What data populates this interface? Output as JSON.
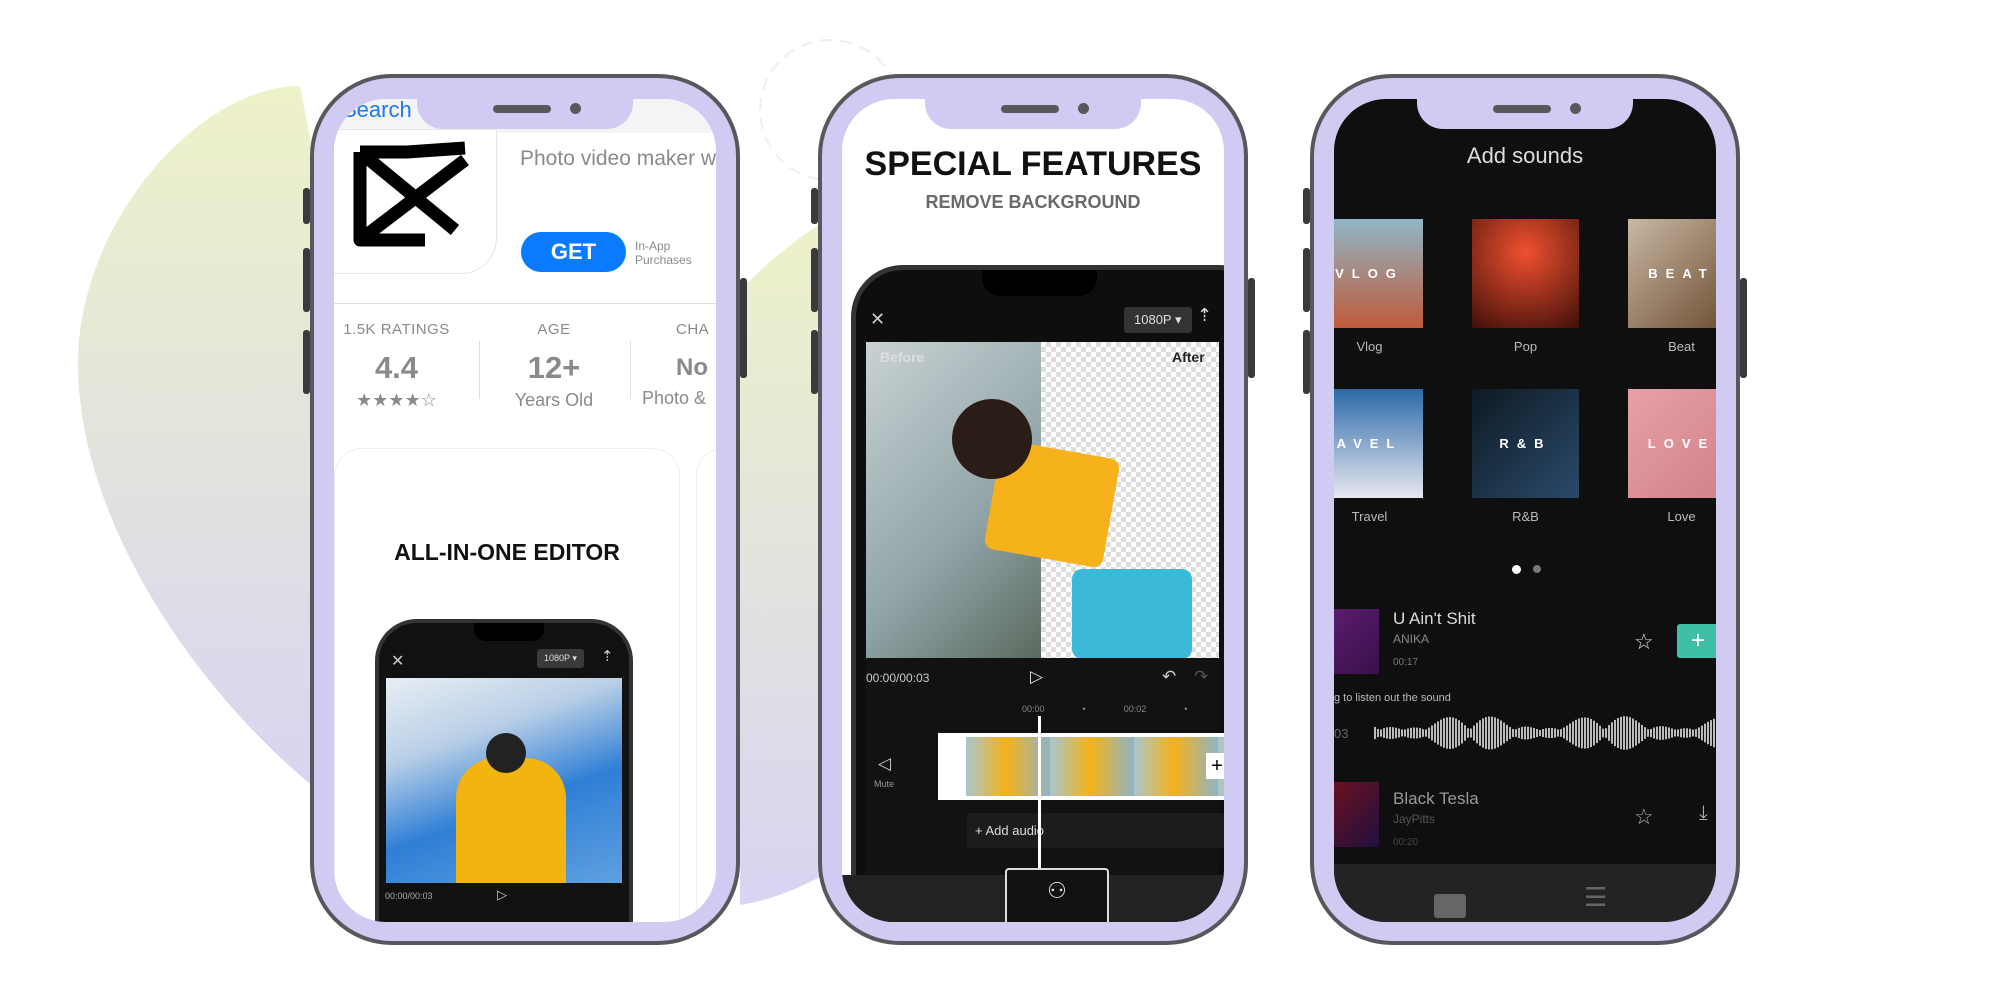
{
  "colors": {
    "frame": "#cfcbf2",
    "frame_border": "#58585c",
    "accent_blue": "#0a7aff",
    "add_teal": "#3fbfa5"
  },
  "phone1": {
    "back_label": "Search",
    "subtitle": "Photo video maker w",
    "get_label": "GET",
    "in_app": [
      "In-App",
      "Purchases"
    ],
    "stats": [
      {
        "label": "1.5K RATINGS",
        "value": "4.4",
        "sub": "★★★★☆",
        "rating": 4.4
      },
      {
        "label": "AGE",
        "value": "12+",
        "sub": "Years Old"
      },
      {
        "label": "CHA",
        "value": "No",
        "sub": "Photo &"
      }
    ],
    "card_title": "ALL-IN-ONE EDITOR",
    "mini": {
      "resolution": "1080P ▾",
      "time": "00:00/00:03"
    }
  },
  "phone2": {
    "title": "SPECIAL FEATURES",
    "subtitle": "REMOVE BACKGROUND",
    "resolution": "1080P ▾",
    "before": "Before",
    "after": "After",
    "time": "00:00/00:03",
    "ruler": [
      "00:00",
      "•",
      "00:02",
      "•"
    ],
    "mute": "Mute",
    "add_audio": "+ Add audio"
  },
  "phone3": {
    "title": "Add sounds",
    "categories": [
      {
        "label": "Vlog",
        "overlay": "VLOG"
      },
      {
        "label": "Pop",
        "overlay": ""
      },
      {
        "label": "Beat",
        "overlay": "BEAT"
      },
      {
        "label": "Travel",
        "overlay": "AVEL"
      },
      {
        "label": "R&B",
        "overlay": "R&B"
      },
      {
        "label": "Love",
        "overlay": "LOVE"
      }
    ],
    "songs": [
      {
        "title": "U Ain't Shit",
        "artist": "ANIKA",
        "duration": "00:17"
      },
      {
        "title": "Black Tesla",
        "artist": "JayPitts",
        "duration": "00:20"
      }
    ],
    "hint": "g to listen out the sound",
    "wave_time": "03"
  }
}
